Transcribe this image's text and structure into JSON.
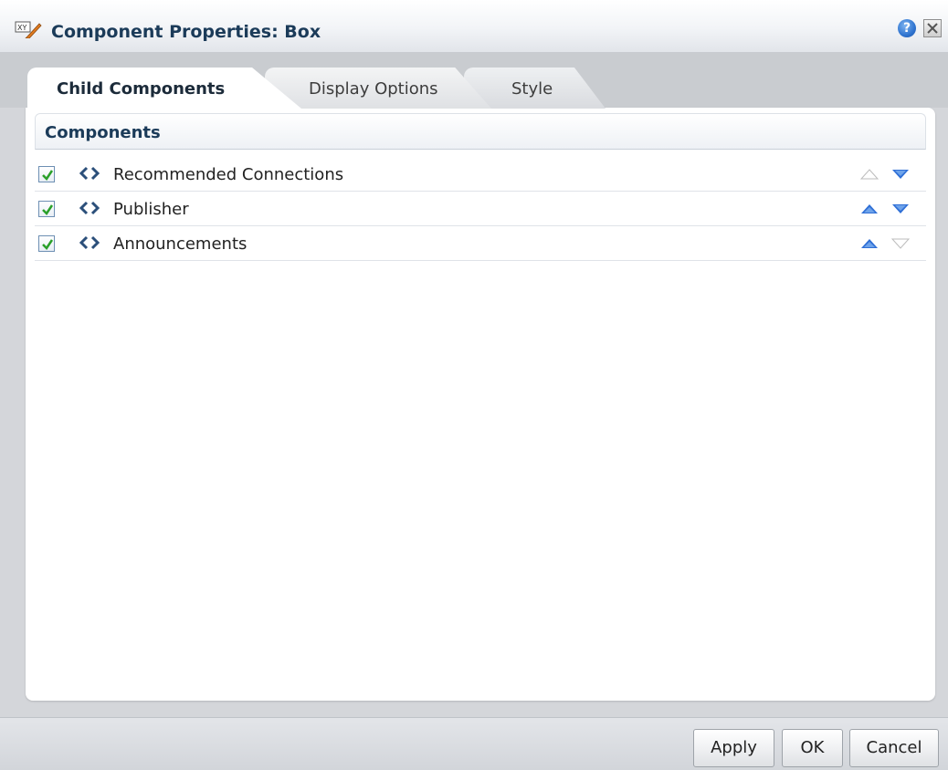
{
  "window": {
    "title": "Component Properties: Box",
    "help_label": "?",
    "title_icon": "edit-properties-icon"
  },
  "tabs": [
    {
      "label": "Child Components",
      "active": true
    },
    {
      "label": "Display Options",
      "active": false
    },
    {
      "label": "Style",
      "active": false
    }
  ],
  "section": {
    "title": "Components"
  },
  "components": [
    {
      "label": "Recommended Connections",
      "checked": true,
      "up_enabled": false,
      "down_enabled": true
    },
    {
      "label": "Publisher",
      "checked": true,
      "up_enabled": true,
      "down_enabled": true
    },
    {
      "label": "Announcements",
      "checked": true,
      "up_enabled": true,
      "down_enabled": false
    }
  ],
  "footer": {
    "apply_label": "Apply",
    "ok_label": "OK",
    "cancel_label": "Cancel"
  },
  "colors": {
    "arrow_enabled": "#2f6fd6",
    "arrow_disabled": "#bcbcbc",
    "check": "#2aa02a",
    "title_text": "#1b3b59"
  }
}
